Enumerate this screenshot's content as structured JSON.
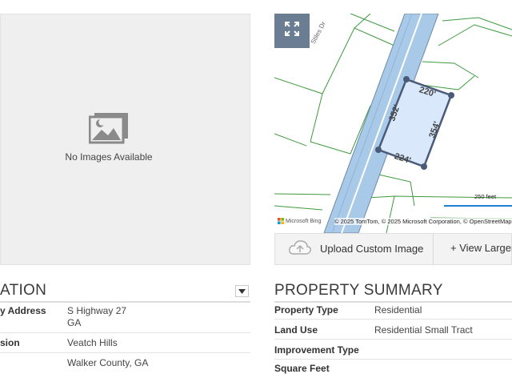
{
  "images": {
    "empty_text": "No Images Available"
  },
  "map": {
    "copyright": "© 2025 TomTom, © 2025 Microsoft Corporation, © OpenStreetMap",
    "provider": "Microsoft Bing",
    "scale_label": "250 feet",
    "road_label": "Stiles Dr",
    "dimensions": {
      "top": "220'",
      "left": "352'",
      "right": "354'",
      "bottom": "224'"
    },
    "colors": {
      "parcel_fill": "#d9e8fb",
      "parcel_stroke": "#4a5a78",
      "lot_lines": "#3e9a3e",
      "road": "#a9c9e8"
    }
  },
  "buttons": {
    "upload": "Upload Custom Image",
    "view_larger": "+ View Larger"
  },
  "location": {
    "title": "ATION",
    "rows": [
      {
        "key": "y Address",
        "value": "S Highway 27",
        "value2": "GA"
      },
      {
        "key": "sion",
        "value": "Veatch Hills"
      },
      {
        "key": "",
        "value": "Walker County, GA"
      }
    ]
  },
  "summary": {
    "title": "PROPERTY SUMMARY",
    "rows": [
      {
        "key": "Property Type",
        "value": "Residential"
      },
      {
        "key": "Land Use",
        "value": "Residential Small Tract"
      },
      {
        "key": "Improvement Type",
        "value": ""
      },
      {
        "key": "Square Feet",
        "value": ""
      }
    ]
  }
}
